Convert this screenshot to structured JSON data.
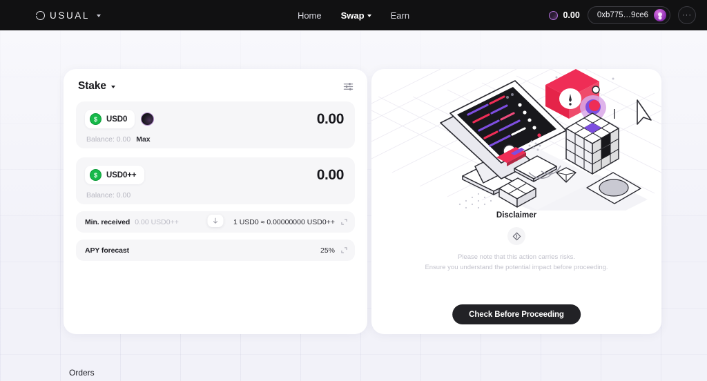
{
  "navbar": {
    "brand": {
      "name": "USUAL",
      "logo_icon": "usual-ring-logo",
      "chevron_icon": "chevron-down-icon"
    },
    "links": [
      {
        "label": "Home",
        "active": false
      },
      {
        "label": "Swap",
        "active": true,
        "chevron_icon": "chevron-down-icon"
      },
      {
        "label": "Earn",
        "active": false
      }
    ],
    "balance": {
      "value": "0.00",
      "icon": "usual-token-icon"
    },
    "wallet": {
      "address": "0xb775…9ce6",
      "avatar_icon": "user-avatar-icon"
    },
    "more_button": {
      "label": "···",
      "icon": "more-horizontal-icon"
    }
  },
  "stake_card": {
    "title": "Stake",
    "title_chevron_icon": "chevron-down-icon",
    "settings_icon": "sliders-settings-icon",
    "from": {
      "token": "USD0",
      "token_icon": "usd0-coin-icon",
      "chain_badge_icon": "network-badge-icon",
      "amount": "0.00",
      "balance_label": "Balance: 0.00",
      "max_label": "Max"
    },
    "swap_direction_icon": "arrow-down-icon",
    "to": {
      "token": "USD0++",
      "token_icon": "usd0pp-coin-icon",
      "amount": "0.00",
      "balance_label": "Balance: 0.00"
    },
    "details": [
      {
        "label": "Min. received",
        "sub": "0.00 USD0++",
        "value": "1 USD0 ≈ 0.00000000 USD0++",
        "expand_icon": "expand-diagonal-icon"
      },
      {
        "label": "APY forecast",
        "sub": "",
        "value": "25%",
        "expand_icon": "expand-diagonal-icon"
      }
    ]
  },
  "disclaimer_card": {
    "illustration_name": "isometric-workstation-illustration",
    "title": "Disclaimer",
    "badge_icon": "warning-diamond-icon",
    "line1": "Please note that this action carries risks.",
    "line2": "Ensure you understand the potential impact before proceeding.",
    "cta_label": "Check Before Proceeding"
  },
  "orders": {
    "title": "Orders"
  },
  "colors": {
    "nav_bg": "#111112",
    "page_bg": "#f1f1f8",
    "card_bg": "#ffffff",
    "accent_green": "#17b94a",
    "accent_purple": "#b06fd8",
    "accent_pink": "#ef2d56",
    "cta_bg": "#222226",
    "muted_text": "#c2c2cc"
  }
}
